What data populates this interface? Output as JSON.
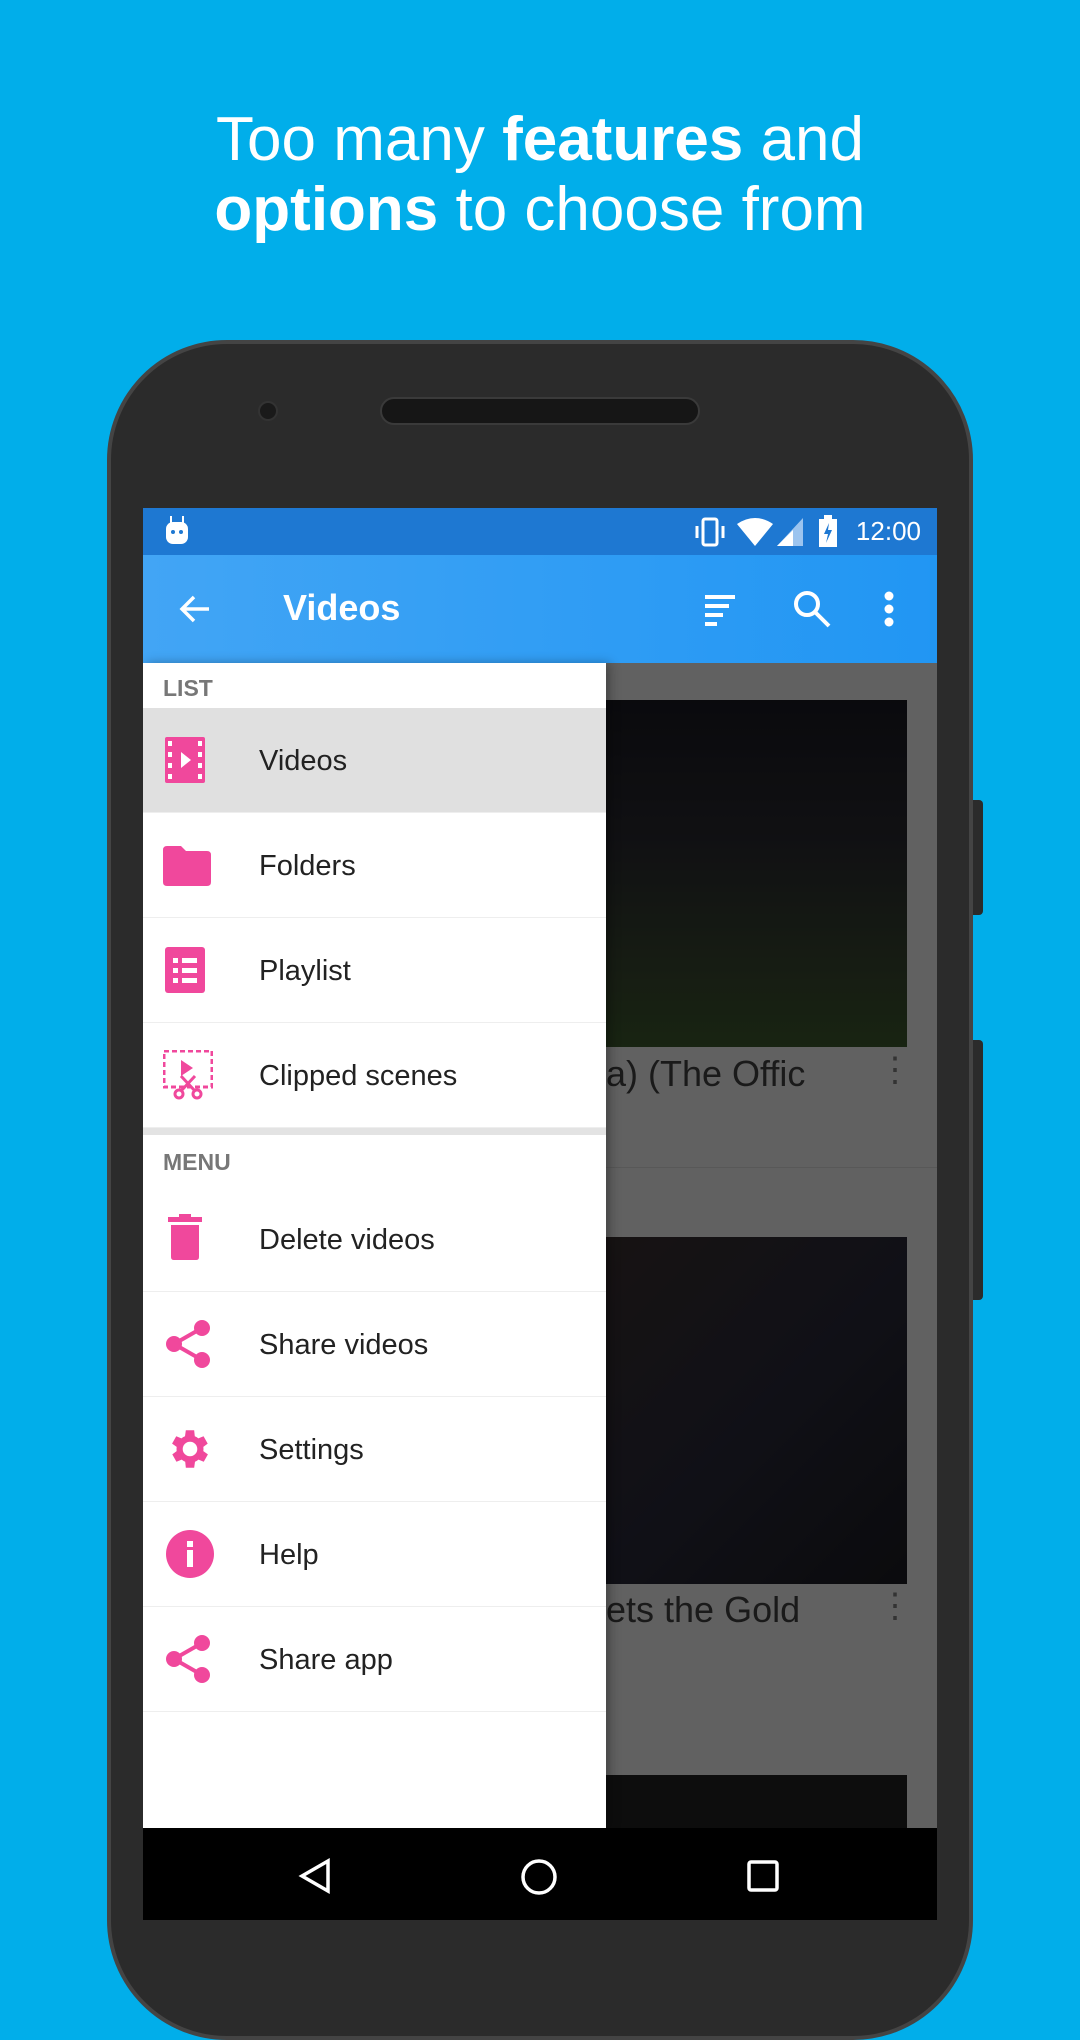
{
  "headline": {
    "line1_pre": "Too many ",
    "line1_bold": "features",
    "line1_post": " and",
    "line2_bold": "options",
    "line2_post": " to choose from"
  },
  "status_bar": {
    "time": "12:00",
    "icons": [
      "android-icon",
      "vibrate-icon",
      "wifi-icon",
      "signal-icon",
      "battery-charging-icon"
    ]
  },
  "app_bar": {
    "title": "Videos",
    "icons": [
      "back-arrow-icon",
      "sort-icon",
      "search-icon",
      "more-vert-icon"
    ]
  },
  "drawer": {
    "list_header": "LIST",
    "list_items": [
      {
        "label": "Videos",
        "icon": "video-film-icon",
        "active": true
      },
      {
        "label": "Folders",
        "icon": "folder-icon"
      },
      {
        "label": "Playlist",
        "icon": "playlist-icon"
      },
      {
        "label": "Clipped scenes",
        "icon": "clipped-scenes-icon"
      }
    ],
    "menu_header": "MENU",
    "menu_items": [
      {
        "label": "Delete videos",
        "icon": "trash-icon"
      },
      {
        "label": "Share videos",
        "icon": "share-icon"
      },
      {
        "label": "Settings",
        "icon": "gear-icon"
      },
      {
        "label": "Help",
        "icon": "info-icon"
      },
      {
        "label": "Share app",
        "icon": "share-icon"
      }
    ]
  },
  "videos": [
    {
      "title": "a) (The Offic"
    },
    {
      "title": "ets the Gold"
    }
  ],
  "colors": {
    "background": "#01aeea",
    "accent": "#f0489c",
    "app_bar": "#2196f3",
    "status_bar": "#1e78d2"
  }
}
